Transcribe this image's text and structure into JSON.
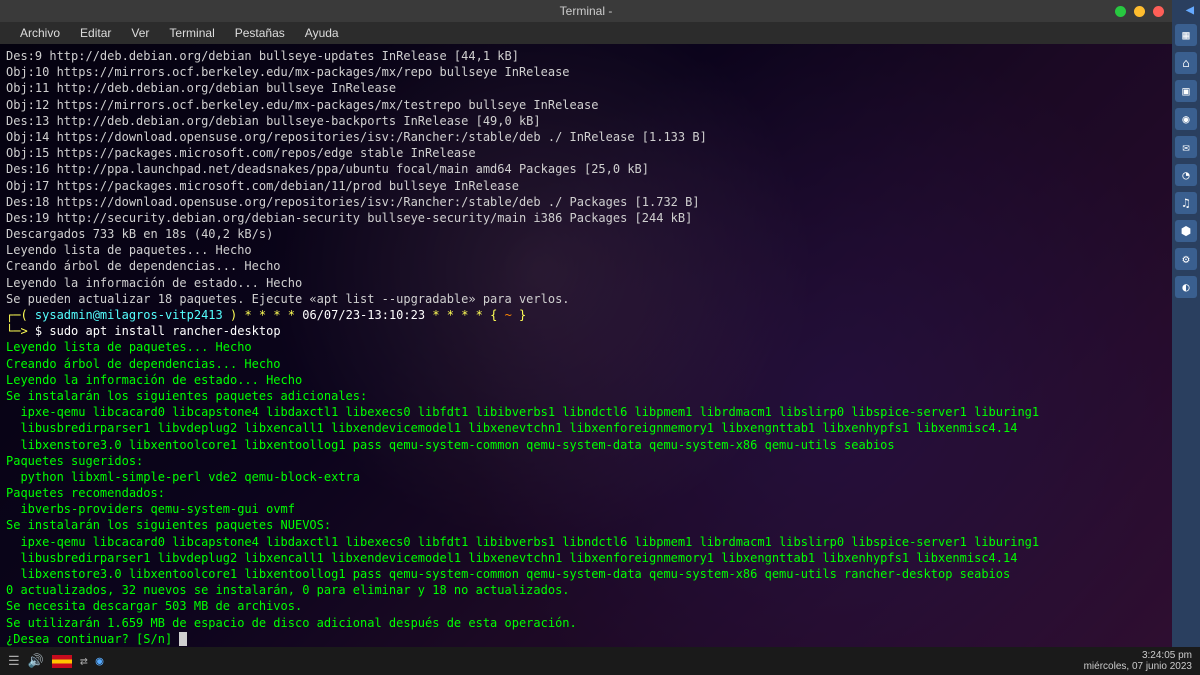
{
  "window": {
    "title": "Terminal -"
  },
  "menu": {
    "file": "Archivo",
    "edit": "Editar",
    "view": "Ver",
    "terminal": "Terminal",
    "tabs": "Pestañas",
    "help": "Ayuda"
  },
  "prompt": {
    "user": "sysadmin@milagros-vitp2413",
    "stars": "* * * *",
    "datetime": "06/07/23-13:10:23",
    "stars2": "* * * *",
    "tilde": "~",
    "symbol": "$",
    "command": "sudo apt install rancher-desktop"
  },
  "lines": {
    "l1": "Des:9 http://deb.debian.org/debian bullseye-updates InRelease [44,1 kB]",
    "l2": "Obj:10 https://mirrors.ocf.berkeley.edu/mx-packages/mx/repo bullseye InRelease",
    "l3": "Obj:11 http://deb.debian.org/debian bullseye InRelease",
    "l4": "Obj:12 https://mirrors.ocf.berkeley.edu/mx-packages/mx/testrepo bullseye InRelease",
    "l5": "Des:13 http://deb.debian.org/debian bullseye-backports InRelease [49,0 kB]",
    "l6": "Obj:14 https://download.opensuse.org/repositories/isv:/Rancher:/stable/deb ./ InRelease [1.133 B]",
    "l7": "Obj:15 https://packages.microsoft.com/repos/edge stable InRelease",
    "l8": "Des:16 http://ppa.launchpad.net/deadsnakes/ppa/ubuntu focal/main amd64 Packages [25,0 kB]",
    "l9": "Obj:17 https://packages.microsoft.com/debian/11/prod bullseye InRelease",
    "l10": "Des:18 https://download.opensuse.org/repositories/isv:/Rancher:/stable/deb ./ Packages [1.732 B]",
    "l11": "Des:19 http://security.debian.org/debian-security bullseye-security/main i386 Packages [244 kB]",
    "l12": "Descargados 733 kB en 18s (40,2 kB/s)",
    "l13": "Leyendo lista de paquetes... Hecho",
    "l14": "Creando árbol de dependencias... Hecho",
    "l15": "Leyendo la información de estado... Hecho",
    "l16": "Se pueden actualizar 18 paquetes. Ejecute «apt list --upgradable» para verlos."
  },
  "post": {
    "p1": "Leyendo lista de paquetes... Hecho",
    "p2": "Creando árbol de dependencias... Hecho",
    "p3": "Leyendo la información de estado... Hecho",
    "p4": "Se instalarán los siguientes paquetes adicionales:",
    "p5": "  ipxe-qemu libcacard0 libcapstone4 libdaxctl1 libexecs0 libfdt1 libibverbs1 libndctl6 libpmem1 librdmacm1 libslirp0 libspice-server1 liburing1",
    "p6": "  libusbredirparser1 libvdeplug2 libxencall1 libxendevicemodel1 libxenevtchn1 libxenforeignmemory1 libxengnttab1 libxenhypfs1 libxenmisc4.14",
    "p7": "  libxenstore3.0 libxentoolcore1 libxentoollog1 pass qemu-system-common qemu-system-data qemu-system-x86 qemu-utils seabios",
    "p8": "Paquetes sugeridos:",
    "p9": "  python libxml-simple-perl vde2 qemu-block-extra",
    "p10": "Paquetes recomendados:",
    "p11": "  ibverbs-providers qemu-system-gui ovmf",
    "p12": "Se instalarán los siguientes paquetes NUEVOS:",
    "p13": "  ipxe-qemu libcacard0 libcapstone4 libdaxctl1 libexecs0 libfdt1 libibverbs1 libndctl6 libpmem1 librdmacm1 libslirp0 libspice-server1 liburing1",
    "p14": "  libusbredirparser1 libvdeplug2 libxencall1 libxendevicemodel1 libxenevtchn1 libxenforeignmemory1 libxengnttab1 libxenhypfs1 libxenmisc4.14",
    "p15": "  libxenstore3.0 libxentoolcore1 libxentoollog1 pass qemu-system-common qemu-system-data qemu-system-x86 qemu-utils rancher-desktop seabios",
    "p16": "0 actualizados, 32 nuevos se instalarán, 0 para eliminar y 18 no actualizados.",
    "p17": "Se necesita descargar 503 MB de archivos.",
    "p18": "Se utilizarán 1.659 MB de espacio de disco adicional después de esta operación.",
    "p19": "¿Desea continuar? [S/n] "
  },
  "taskbar": {
    "time": "3:24:05 pm",
    "date": "miércoles, 07 junio 2023"
  }
}
